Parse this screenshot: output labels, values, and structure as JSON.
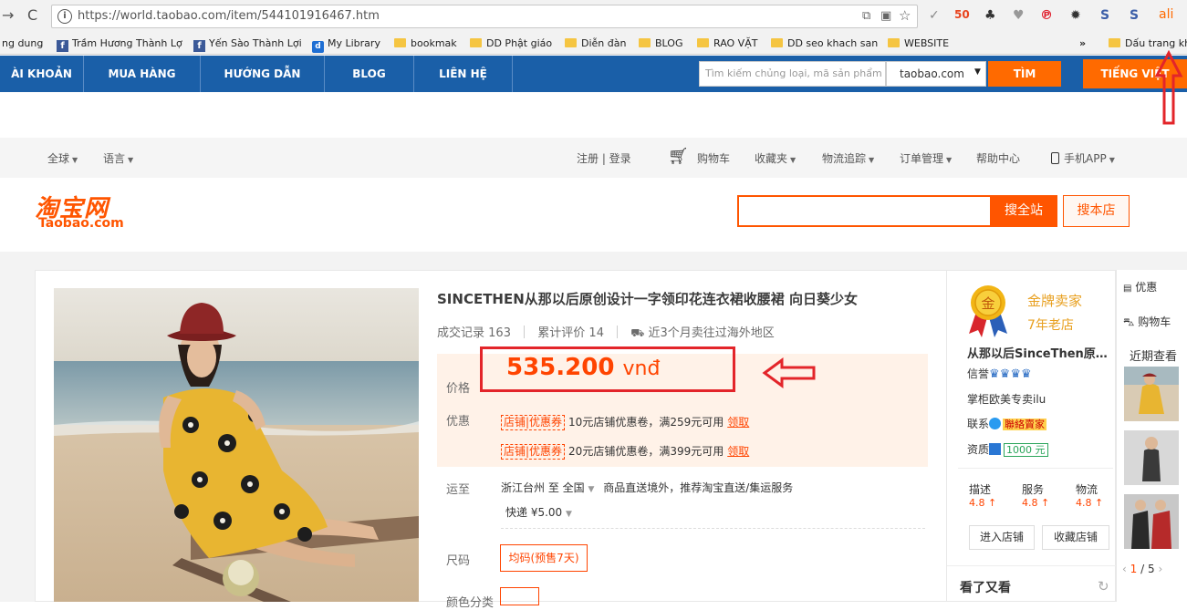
{
  "browser": {
    "url": "https://world.taobao.com/item/544101916467.htm",
    "ali_ext": "ali"
  },
  "bookmarks": [
    {
      "label": "ng dung",
      "icon": "none"
    },
    {
      "label": "Trầm Hương Thành Lợ",
      "icon": "facebook-icon"
    },
    {
      "label": "Yến Sào Thành Lợi",
      "icon": "facebook-icon"
    },
    {
      "label": "My Library",
      "icon": "library-icon"
    },
    {
      "label": "bookmak",
      "icon": "folder-icon"
    },
    {
      "label": "DD Phật giáo",
      "icon": "folder-icon"
    },
    {
      "label": "Diễn đàn",
      "icon": "folder-icon"
    },
    {
      "label": "BLOG",
      "icon": "folder-icon"
    },
    {
      "label": "RAO VẶT",
      "icon": "folder-icon"
    },
    {
      "label": "DD seo khach san",
      "icon": "folder-icon"
    },
    {
      "label": "WEBSITE",
      "icon": "folder-icon"
    }
  ],
  "bookmarks_overflow": "»",
  "bookmark_right": "Dấu trang kh",
  "vnnav": {
    "items": [
      "ÀI KHOẢN",
      "MUA HÀNG",
      "HƯỚNG DẪN",
      "BLOG",
      "LIÊN HỆ"
    ],
    "search_placeholder": "Tìm kiếm chủng loại, mã sản phẩm",
    "site_select": "taobao.com",
    "search_button": "TÌM",
    "lang_button": "TIẾNG VIỆT"
  },
  "tbtop": {
    "global": "全球",
    "language": "语言",
    "login": "注册 | 登录",
    "cart": "购物车",
    "favorites": "收藏夹",
    "logistics": "物流追踪",
    "orders": "订单管理",
    "help": "帮助中心",
    "app": "手机APP"
  },
  "logo": {
    "cn": "淘宝网",
    "en": "Taobao.com"
  },
  "search": {
    "all": "搜全站",
    "shop": "搜本店"
  },
  "product": {
    "title": "SINCETHEN从那以后原创设计一字领印花连衣裙收腰裙 向日葵少女",
    "deals_label": "成交记录",
    "deals": "163",
    "reviews_label": "累计评价",
    "reviews": "14",
    "overseas": "近3个月卖往过海外地区",
    "price_label": "价格",
    "price": "535.200",
    "price_unit": "vnđ",
    "promo_label": "优惠",
    "coupons": [
      {
        "tag": "店铺|优惠券",
        "text": "10元店铺优惠卷，满259元可用",
        "link": "领取"
      },
      {
        "tag": "店铺|优惠券",
        "text": "20元店铺优惠卷，满399元可用",
        "link": "领取"
      }
    ],
    "ship_label": "运至",
    "ship_from": "浙江台州 至",
    "ship_to": "全国",
    "ship_note": "商品直送境外，推荐淘宝直送/集运服务",
    "ship_fee": "快递 ¥5.00",
    "size_label": "尺码",
    "size_option": "均码(预售7天)",
    "color_label": "颜色分类"
  },
  "seller": {
    "badge": "金",
    "level": "金牌卖家",
    "years": "7年老店",
    "shop_name": "从那以后SinceThen原创设计",
    "credit_label": "信誉",
    "keeper": "掌柜欧美专卖ilu",
    "contact_label": "联系",
    "contact_badge": "聯絡賣家",
    "qual_label": "资质",
    "qual_amount": "1000 元",
    "scores": [
      {
        "label": "描述",
        "value": "4.8"
      },
      {
        "label": "服务",
        "value": "4.8"
      },
      {
        "label": "物流",
        "value": "4.8"
      }
    ],
    "enter_shop": "进入店铺",
    "fav_shop": "收藏店铺",
    "see_also": "看了又看"
  },
  "rightbar": {
    "promo": "优惠",
    "cart": "购物车",
    "recent": "近期查看",
    "pager_current": "1",
    "pager_total": "/ 5"
  },
  "colors": {
    "taobao_orange": "#ff5500",
    "vn_blue": "#1a5fa8",
    "annotation_red": "#e3252a",
    "gold": "#e8a020"
  }
}
